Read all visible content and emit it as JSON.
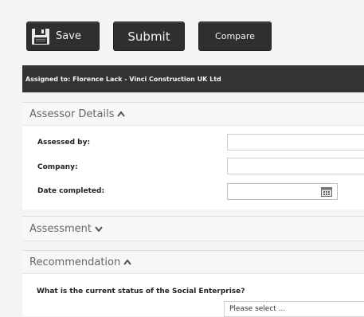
{
  "toolbar": {
    "save_label": "Save",
    "submit_label": "Submit",
    "compare_label": "Compare"
  },
  "assigned": {
    "text": "Assigned to: Florence Lack - Vinci Construction UK Ltd"
  },
  "assessor_details": {
    "title": "Assessor Details",
    "fields": {
      "assessed_by_label": "Assessed by:",
      "assessed_by_value": "",
      "company_label": "Company:",
      "company_value": "",
      "date_completed_label": "Date completed:",
      "date_completed_value": ""
    }
  },
  "assessment": {
    "title": "Assessment"
  },
  "recommendation": {
    "title": "Recommendation",
    "question": "What is the current status of the Social Enterprise?",
    "select_value": "Please select ..."
  },
  "icons": {
    "save": "floppy-disk-icon",
    "collapse": "chevron-up-icon",
    "expand": "chevron-down-icon",
    "calendar": "calendar-icon"
  },
  "colors": {
    "button_bg": "#2f2f2f",
    "assigned_bar_bg": "#333333",
    "page_bg": "#f4f4f4"
  }
}
